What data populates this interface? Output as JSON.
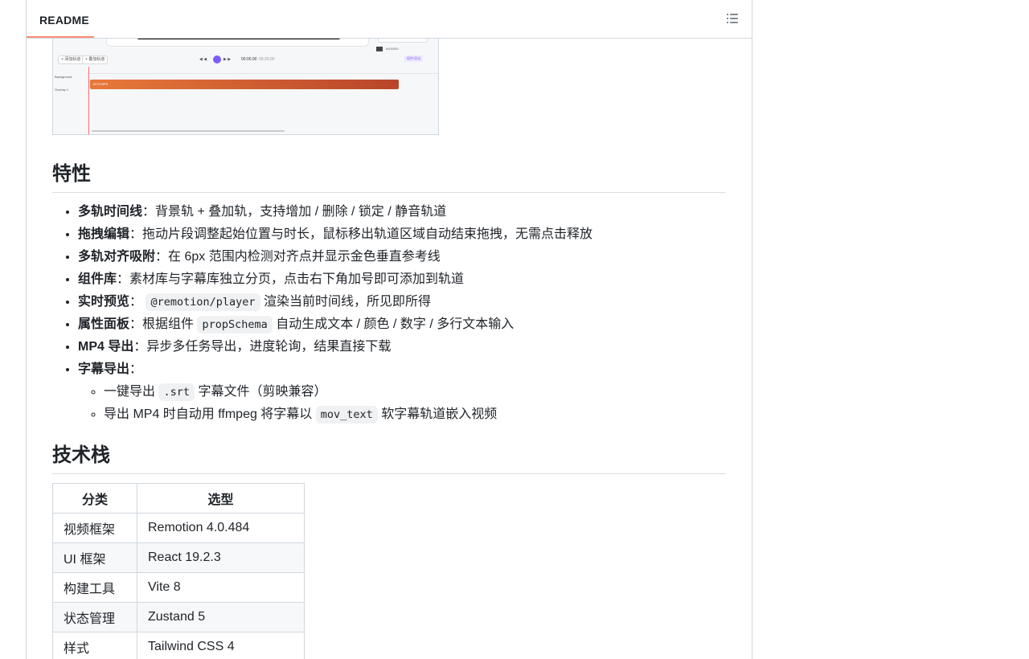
{
  "header": {
    "tab_label": "README",
    "outline_icon": "list-unordered-icon"
  },
  "preview": {
    "btn_a": "+ 添加轨道",
    "btn_b": "+ 叠加轨道",
    "time_a": "00:00.00",
    "time_b": "00:20.00",
    "track_bg": "Background",
    "track_overlay": "Overlay 1",
    "clip_label": "MYCHIPS",
    "side_value": "#000000",
    "side_tag": "组件/导出"
  },
  "features": {
    "heading": "特性",
    "items": [
      {
        "title": "多轨时间线",
        "text": "：背景轨 + 叠加轨，支持增加 / 删除 / 锁定 / 静音轨道"
      },
      {
        "title": "拖拽编辑",
        "text": "：拖动片段调整起始位置与时长，鼠标移出轨道区域自动结束拖拽，无需点击释放"
      },
      {
        "title": "多轨对齐吸附",
        "text": "：在 6px 范围内检测对齐点并显示金色垂直参考线"
      },
      {
        "title": "组件库",
        "text": "：素材库与字幕库独立分页，点击右下角加号即可添加到轨道"
      },
      {
        "title": "实时预览",
        "sep": "：",
        "code": "@remotion/player",
        "text": "渲染当前时间线，所见即所得"
      },
      {
        "title": "属性面板",
        "pre": "：根据组件",
        "code": "propSchema",
        "text": "自动生成文本 / 颜色 / 数字 / 多行文本输入"
      },
      {
        "title": "MP4 导出",
        "text": "：异步多任务导出，进度轮询，结果直接下载"
      },
      {
        "title": "字幕导出",
        "text": "："
      }
    ],
    "sub_items": [
      {
        "pre": "一键导出",
        "code": ".srt",
        "text": "字幕文件（剪映兼容）"
      },
      {
        "pre": "导出 MP4 时自动用 ffmpeg 将字幕以",
        "code": "mov_text",
        "text": "软字幕轨道嵌入视频"
      }
    ]
  },
  "stack": {
    "heading": "技术栈",
    "headers": [
      "分类",
      "选型"
    ],
    "rows": [
      [
        "视频框架",
        "Remotion 4.0.484"
      ],
      [
        "UI 框架",
        "React 19.2.3"
      ],
      [
        "构建工具",
        "Vite 8"
      ],
      [
        "状态管理",
        "Zustand 5"
      ],
      [
        "样式",
        "Tailwind CSS 4"
      ]
    ]
  }
}
